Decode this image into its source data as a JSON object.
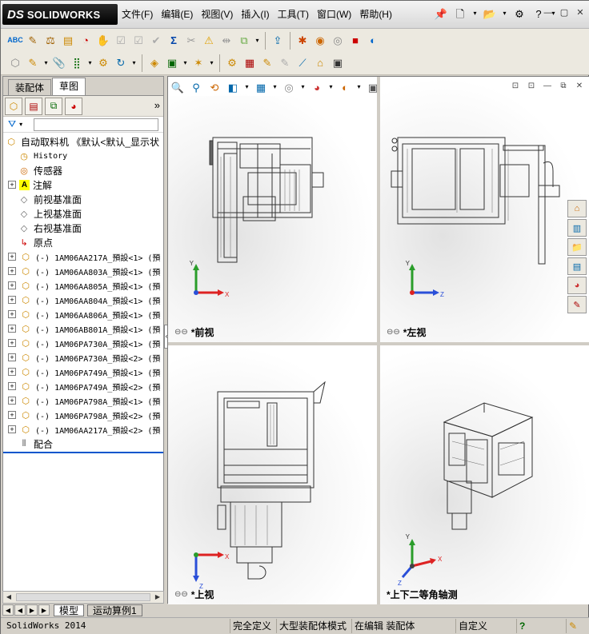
{
  "app": {
    "logo_text": "SOLIDWORKS",
    "logo_ds": "DS"
  },
  "menu": [
    "文件(F)",
    "编辑(E)",
    "视图(V)",
    "插入(I)",
    "工具(T)",
    "窗口(W)",
    "帮助(H)"
  ],
  "window_controls": [
    "—",
    "▢",
    "✕"
  ],
  "panel_tabs": {
    "tab1": "装配体",
    "tab2": "草图"
  },
  "tree": {
    "root": "自动取料机  《默认<默认_显示状",
    "history": "History",
    "sensors": "传感器",
    "annotations": "注解",
    "front_plane": "前视基准面",
    "top_plane": "上视基准面",
    "right_plane": "右视基准面",
    "origin": "原点",
    "components": [
      "(-) 1AM06AA217A_預設<1>  (預",
      "(-) 1AM06AA803A_預設<1>  (預",
      "(-) 1AM06AA805A_預設<1>  (預",
      "(-) 1AM06AA804A_預設<1>  (預",
      "(-) 1AM06AA806A_預設<1>  (預",
      "(-) 1AM06AB801A_預設<1>  (預",
      "(-) 1AM06PA730A_預設<1>  (預",
      "(-) 1AM06PA730A_預設<2>  (預",
      "(-) 1AM06PA749A_預設<1>  (預",
      "(-) 1AM06PA749A_預設<2>  (預",
      "(-) 1AM06PA798A_預設<1>  (預",
      "(-) 1AM06PA798A_預設<2>  (預",
      "(-) 1AM06AA217A_預設<2>  (預"
    ],
    "mates": "配合"
  },
  "bottom_tabs": {
    "model": "模型",
    "motion": "运动算例1"
  },
  "views": {
    "front": "*前视",
    "left": "*左视",
    "top": "*上视",
    "iso": "*上下二等角轴测"
  },
  "axes": {
    "x": "X",
    "y": "Y",
    "z": "Z"
  },
  "status": {
    "app": "SolidWorks 2014",
    "defined": "完全定义",
    "mode": "大型装配体模式",
    "editing": "在编辑 装配体",
    "custom": "自定义",
    "help": "?"
  }
}
